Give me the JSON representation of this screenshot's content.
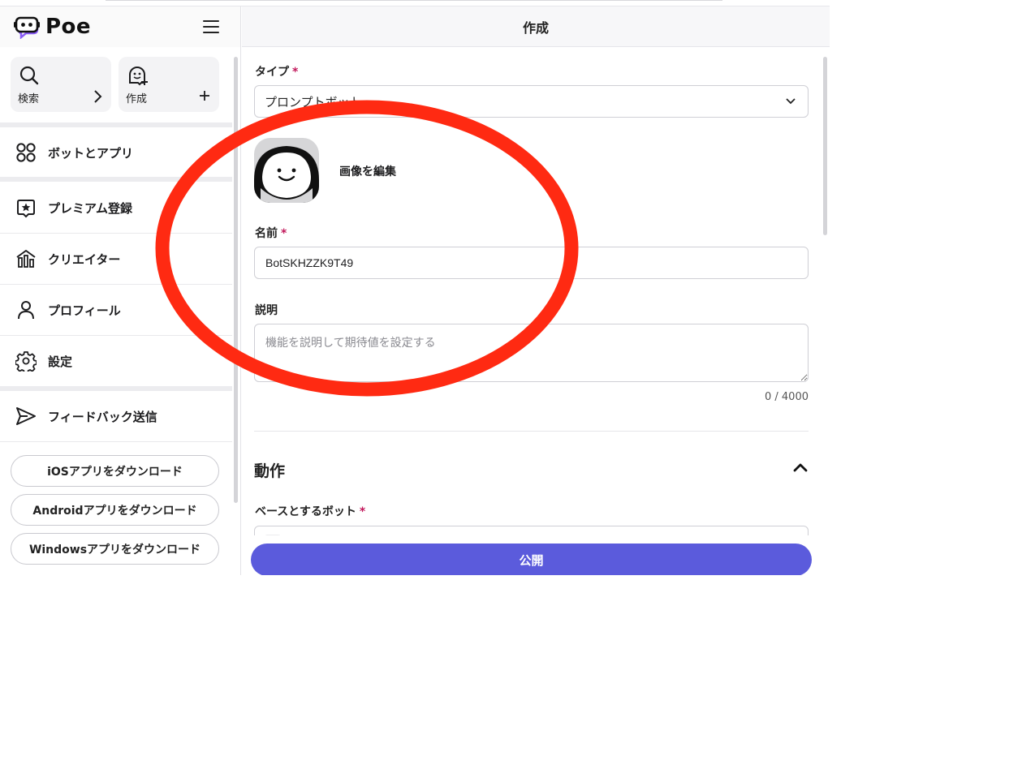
{
  "app": {
    "name": "Poe"
  },
  "sidebar": {
    "quick_actions": [
      {
        "label": "検索",
        "icon": "search-icon",
        "action_icon": "chevron-right-icon"
      },
      {
        "label": "作成",
        "icon": "create-bot-icon",
        "action_icon": "plus-icon"
      }
    ],
    "items": [
      {
        "label": "ボットとアプリ",
        "icon": "bots-apps-icon"
      },
      {
        "label": "プレミアム登録",
        "icon": "premium-icon"
      },
      {
        "label": "クリエイター",
        "icon": "creator-icon"
      },
      {
        "label": "プロフィール",
        "icon": "profile-icon"
      },
      {
        "label": "設定",
        "icon": "gear-icon"
      },
      {
        "label": "フィードバック送信",
        "icon": "send-icon"
      }
    ],
    "downloads": [
      "iOSアプリをダウンロード",
      "Androidアプリをダウンロード",
      "Windowsアプリをダウンロード"
    ]
  },
  "main": {
    "title": "作成",
    "type_field": {
      "label": "タイプ",
      "required": "*",
      "value": "プロンプトボット"
    },
    "avatar": {
      "edit_label": "画像を編集"
    },
    "name_field": {
      "label": "名前",
      "required": "*",
      "value": "BotSKHZZK9T49"
    },
    "description_field": {
      "label": "説明",
      "placeholder": "機能を説明して期待値を設定する",
      "counter": "0 / 4000"
    },
    "behavior_section": {
      "title": "動作"
    },
    "base_bot_field": {
      "label": "ベースとするボット",
      "required": "*"
    },
    "publish_label": "公開"
  },
  "colors": {
    "accent": "#5b5bdc",
    "annotation": "#ff2a12",
    "required": "#c2185b"
  }
}
